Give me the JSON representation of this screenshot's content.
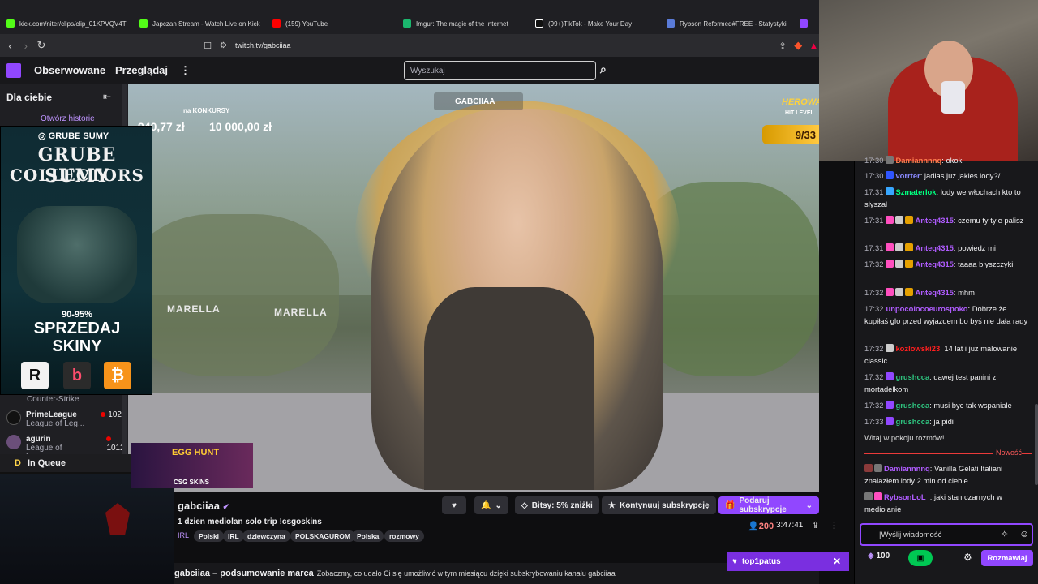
{
  "browser": {
    "tabs": [
      "kick.com/niter/clips/clip_01KPVQV4T",
      "Japczan Stream - Watch Live on Kick",
      "(159) YouTube",
      "Imgur: The magic of the Internet",
      "(99+)TikTok - Make Your Day",
      "Rybson Reformed#FREE - Statystyki"
    ],
    "url": "twitch.tv/gabciiaa"
  },
  "nav": {
    "followed": "Obserwowane",
    "browse": "Przeglądaj",
    "search_placeholder": "Wyszukaj"
  },
  "sidebar": {
    "title": "Dla ciebie",
    "story": "Otwórz historie",
    "items": [
      {
        "name": "",
        "game": "Counter-Strike",
        "viewers": ""
      },
      {
        "name": "PrimeLeague",
        "game": "League of Leg...",
        "viewers": "1026"
      },
      {
        "name": "agurin",
        "game": "League of Leg...",
        "viewers": "1012"
      }
    ]
  },
  "overlay": {
    "konkurs": "na KONKURSY",
    "amount1": "940,77 zł",
    "amount2": "10 000,00 zł",
    "channel": "GABCIIAA",
    "hero_top": "HEROWA",
    "hero_sub": "HIT LEVEL",
    "hero_level": "9/33",
    "store1": "MARELLA",
    "store2": "MARELLA"
  },
  "promo": {
    "ig": "GRUBE SUMY",
    "title1": "GRUBE SUMY",
    "title2": "COLLECTORS",
    "discount": "90-95%",
    "sell1": "SPRZEDAJ",
    "sell2": "SKINY"
  },
  "queue": {
    "title": "In Queue"
  },
  "egghunt": {
    "label": "EGG HUNT",
    "skins": "CSG SKINS"
  },
  "stream": {
    "streamer": "gabciiaa",
    "title": "1 dzien mediolan solo trip !csgoskins",
    "category": "IRL",
    "tags": [
      "Polski",
      "IRL",
      "dziewczyna",
      "POLSKAGUROM",
      "Polska",
      "rozmowy"
    ],
    "viewers": "200",
    "uptime": "3:47:41",
    "bits": "Bitsy: 5% zniżki",
    "continue_sub": "Kontynuuj subskrypcję",
    "gift_sub": "Podaruj subskrypcje",
    "recap_title": "gabciiaa – podsumowanie marca",
    "recap_text": "Zobaczmy, co udało Ci się umożliwić w tym miesiącu dzięki subskrybowaniu kanału gabciiaa"
  },
  "chat": {
    "messages": [
      {
        "t": "17:30",
        "u": "Damiannnnq",
        "c": "#ff7f50",
        "m": ": okok"
      },
      {
        "t": "17:30",
        "u": "vorrter",
        "c": "#8a8aff",
        "m": ": jadlas juz jakies lody?/"
      },
      {
        "t": "17:31",
        "u": "Szmaterlok",
        "c": "#00ff7f",
        "m": ": lody we włochach kto to slyszał"
      },
      {
        "t": "17:31",
        "u": "Anteq4315",
        "c": "#b05cff",
        "m": ": czemu ty tyle palisz"
      },
      {
        "t": "17:31",
        "u": "Anteq4315",
        "c": "#b05cff",
        "m": ": powiedz mi"
      },
      {
        "t": "17:32",
        "u": "Anteq4315",
        "c": "#b05cff",
        "m": ": taaaa blyszczyki"
      },
      {
        "t": "17:32",
        "u": "Anteq4315",
        "c": "#b05cff",
        "m": ": mhm"
      },
      {
        "t": "17:32",
        "u": "unpocolocoeurospoko",
        "c": "#b05cff",
        "m": ": Dobrze że kupiłaś glo przed wyjazdem bo byś nie dała rady"
      },
      {
        "t": "17:32",
        "u": "kozlowski23",
        "c": "#ff1f1f",
        "m": ": 14 lat i juz malowanie classic"
      },
      {
        "t": "17:32",
        "u": "grushcca",
        "c": "#2ec27e",
        "m": ": dawej test panini z mortadelkom"
      },
      {
        "t": "17:32",
        "u": "grushcca",
        "c": "#2ec27e",
        "m": ": musi byc tak wspaniale"
      },
      {
        "t": "17:33",
        "u": "grushcca",
        "c": "#2ec27e",
        "m": ": ja pidi"
      }
    ],
    "welcome": "Witaj w pokoju rozmów!",
    "new_label": "Nowość",
    "new_messages": [
      {
        "u": "Damiannnnq",
        "c": "#b05cff",
        "m": ": Vanilla Gelati Italiani znalazłem lody 2 min od ciebie"
      },
      {
        "u": "RybsonLoL_",
        "c": "#b05cff",
        "m": ": jaki stan czarnych w mediolanie"
      }
    ],
    "input_placeholder": "|Wyślij wiadomość",
    "points": "100",
    "send": "Rozmawiaj"
  },
  "toast": {
    "user": "top1patus"
  }
}
